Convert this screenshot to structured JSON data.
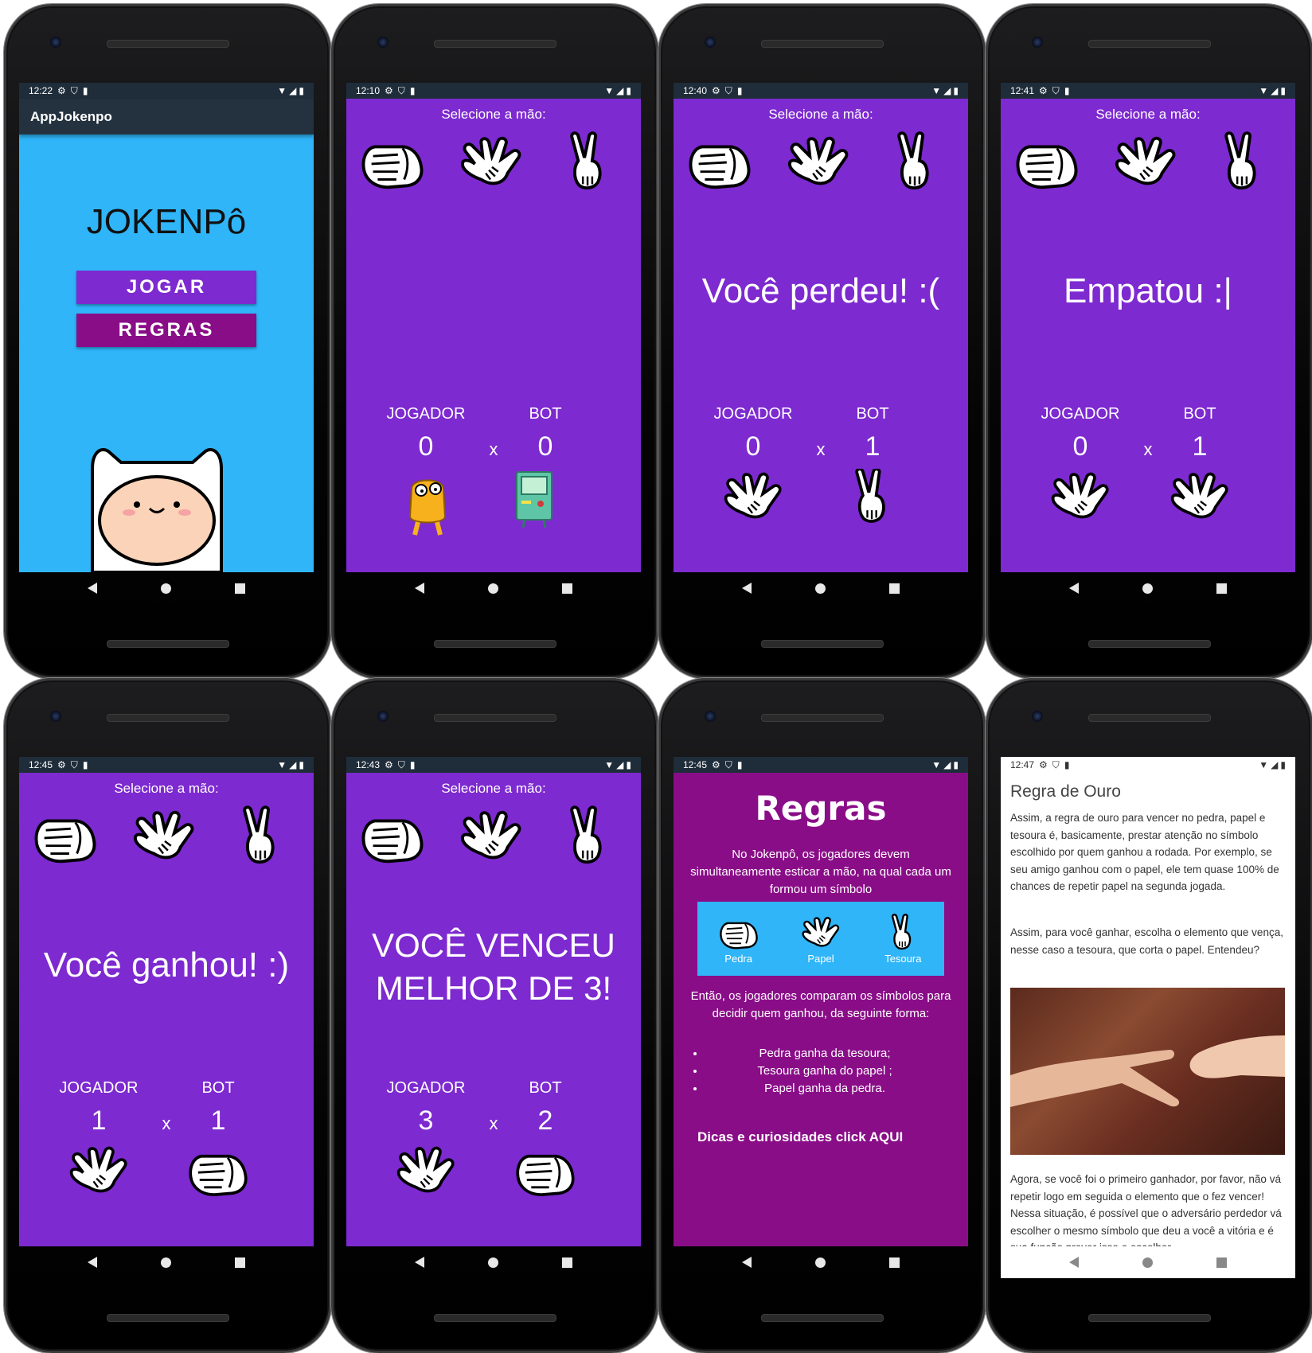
{
  "phones": [
    {
      "time": "12:22"
    },
    {
      "time": "12:10"
    },
    {
      "time": "12:40"
    },
    {
      "time": "12:41"
    },
    {
      "time": "12:45"
    },
    {
      "time": "12:43"
    },
    {
      "time": "12:45"
    },
    {
      "time": "12:47"
    }
  ],
  "home": {
    "app_title": "AppJokenpo",
    "title": "JOKENPô",
    "play_label": "JOGAR",
    "rules_label": "REGRAS"
  },
  "game": {
    "select_label": "Selecione a mão:",
    "player_label": "JOGADOR",
    "bot_label": "BOT",
    "vs": "x"
  },
  "screens": [
    {
      "result": "",
      "player_score": "0",
      "bot_score": "0"
    },
    {
      "result": "Você perdeu! :(",
      "player_score": "0",
      "bot_score": "1"
    },
    {
      "result": "Empatou :|",
      "player_score": "0",
      "bot_score": "1"
    },
    {
      "result": "Você ganhou! :)",
      "player_score": "1",
      "bot_score": "1"
    },
    {
      "result_line1": "VOCÊ VENCEU",
      "result_line2": "MELHOR DE 3!",
      "player_score": "3",
      "bot_score": "2"
    }
  ],
  "rules": {
    "title": "Regras",
    "intro": "No Jokenpô, os jogadores devem simultaneamente esticar a mão, na qual cada um formou um símbolo",
    "items": [
      "Pedra",
      "Papel",
      "Tesoura"
    ],
    "compare": "Então, os jogadores comparam os símbolos para decidir quem ganhou, da seguinte forma:",
    "list": [
      "Pedra ganha da tesoura;",
      "Tesoura ganha do papel ;",
      "Papel ganha da pedra."
    ],
    "link": "Dicas e curiosidades click AQUI"
  },
  "article": {
    "title": "Regra de Ouro",
    "p1": "Assim, a regra de ouro para vencer no pedra, papel e tesoura é, basicamente, prestar atenção no símbolo escolhido por quem ganhou a rodada. Por exemplo, se seu amigo ganhou com o papel, ele tem quase 100% de chances de repetir papel na segunda jogada.",
    "p2": "Assim, para você ganhar, escolha o elemento que vença, nesse caso a tesoura, que corta o papel. Entendeu?",
    "p3": "Agora, se você foi o primeiro ganhador, por favor, não vá repetir logo em seguida o elemento que o fez vencer! Nessa situação, é possível que o adversário perdedor vá escolher o mesmo símbolo que deu a você a vitória e é sua função prever isso e escolher"
  },
  "colors": {
    "purple": "#7d2ad0",
    "magenta": "#8a0d88",
    "sky": "#2fb5f8",
    "statusbar": "#1f2d3b"
  }
}
